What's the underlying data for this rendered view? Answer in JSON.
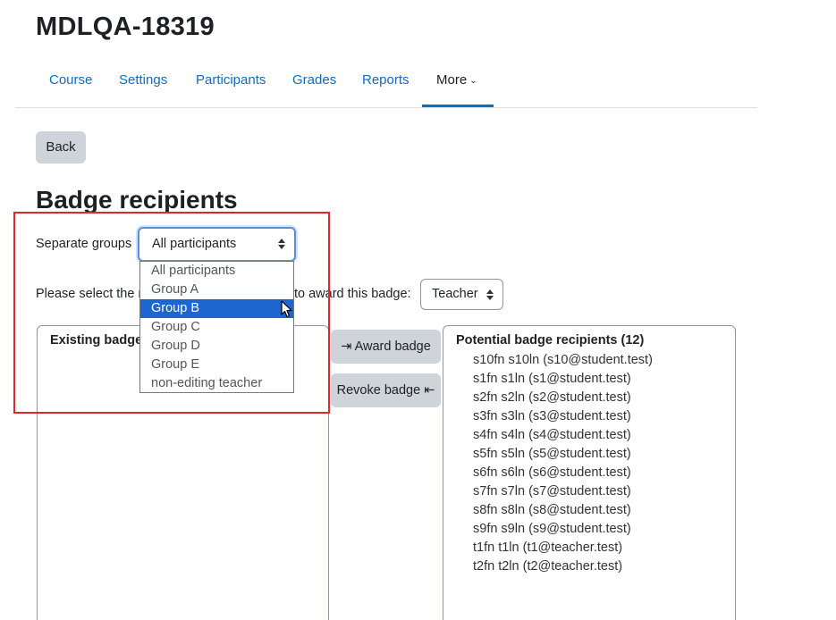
{
  "course": {
    "title": "MDLQA-18319"
  },
  "nav": {
    "items": [
      "Course",
      "Settings",
      "Participants",
      "Grades",
      "Reports"
    ],
    "more_label": "More"
  },
  "back_label": "Back",
  "section_title": "Badge recipients",
  "groups": {
    "label": "Separate groups",
    "selected": "All participants",
    "options": [
      "All participants",
      "Group A",
      "Group B",
      "Group C",
      "Group D",
      "Group E",
      "non-editing teacher"
    ],
    "highlighted_option": "Group B"
  },
  "role": {
    "label_start": "Please select the r",
    "label_end": "to award this badge:",
    "selected": "Teacher"
  },
  "existing": {
    "header": "Existing badge"
  },
  "actions": {
    "award": "Award badge",
    "revoke": "Revoke badge"
  },
  "potential": {
    "header": "Potential badge recipients (12)",
    "users": [
      "s10fn s10ln (s10@student.test)",
      "s1fn s1ln (s1@student.test)",
      "s2fn s2ln (s2@student.test)",
      "s3fn s3ln (s3@student.test)",
      "s4fn s4ln (s4@student.test)",
      "s5fn s5ln (s5@student.test)",
      "s6fn s6ln (s6@student.test)",
      "s7fn s7ln (s7@student.test)",
      "s8fn s8ln (s8@student.test)",
      "s9fn s9ln (s9@student.test)",
      "t1fn t1ln (t1@teacher.test)",
      "t2fn t2ln (t2@teacher.test)"
    ]
  },
  "colors": {
    "link": "#0f6cbf",
    "button_bg": "#ced4da",
    "selected_option_bg": "#1e66cf",
    "highlight_border": "#e3262d"
  }
}
